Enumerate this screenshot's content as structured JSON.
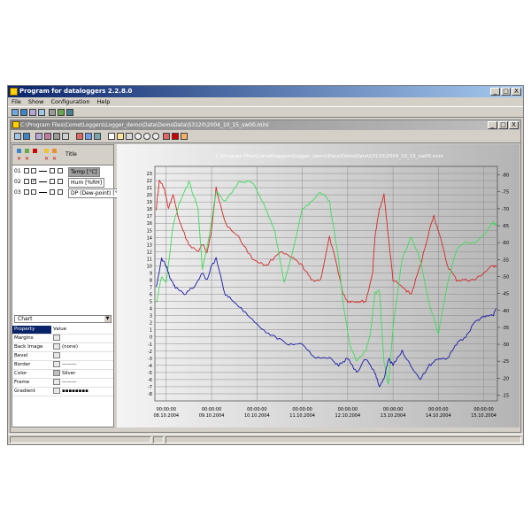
{
  "window": {
    "title": "Program for dataloggers   2.2.8.0",
    "controls": [
      "_",
      "□",
      "X"
    ]
  },
  "menu": [
    "File",
    "Show",
    "Configuration",
    "Help"
  ],
  "document": {
    "path": "C:\\Program Files\\CometLoggers\\Logger_demo\\Data\\DemoData\\S3120\\2004_10_15_sw00.mini",
    "controls": [
      "_",
      "□",
      "X"
    ]
  },
  "series_panel": {
    "headers": {
      "title": "Title"
    },
    "rows": [
      {
        "num": "01",
        "title": "Temp [°C]",
        "selected": true,
        "checked": false
      },
      {
        "num": "02",
        "title": "Hum [%RH]",
        "selected": false,
        "checked": true
      },
      {
        "num": "03",
        "title": "DP (Dew-point) [°C]",
        "selected": false,
        "checked": false
      }
    ]
  },
  "property_panel": {
    "object": "Chart",
    "header": {
      "key": "Property",
      "value": "Value"
    },
    "rows": [
      {
        "key": "Margins",
        "value": ""
      },
      {
        "key": "Back Image",
        "value": "(none)"
      },
      {
        "key": "Bevel",
        "value": ""
      },
      {
        "key": "Border",
        "value": "———"
      },
      {
        "key": "Color",
        "value": "Silver"
      },
      {
        "key": "Frame",
        "value": "———"
      },
      {
        "key": "Gradient",
        "value": "▪▪▪▪▪▪▪▪"
      }
    ]
  },
  "colors": {
    "temp": "#d42a2a",
    "hum": "#3ddc5a",
    "dew": "#1a1aa8",
    "grid": "#8a8a8a"
  },
  "chart_data": {
    "type": "line",
    "title": "C:\\Program Files\\CometLoggers\\Logger_demo\\Data\\DemoData\\S3120\\2004_10_15_sw00.mini",
    "x_ticks": [
      {
        "time": "00:00:00",
        "date": "08.10.2004"
      },
      {
        "time": "00:00:00",
        "date": "09.10.2004"
      },
      {
        "time": "00:00:00",
        "date": "10.10.2004"
      },
      {
        "time": "00:00:00",
        "date": "11.10.2004"
      },
      {
        "time": "00:00:00",
        "date": "12.10.2004"
      },
      {
        "time": "00:00:00",
        "date": "13.10.2004"
      },
      {
        "time": "00:00:00",
        "date": "14.10.2004"
      },
      {
        "time": "00:00:00",
        "date": "15.10.2004"
      }
    ],
    "xlim": [
      7.75,
      15.3
    ],
    "y_left": {
      "ylim": [
        -9,
        24
      ],
      "ticks": [
        -8,
        -7,
        -6,
        -5,
        -4,
        -3,
        -2,
        -1,
        0,
        1,
        2,
        3,
        4,
        5,
        6,
        7,
        8,
        9,
        10,
        11,
        12,
        13,
        14,
        15,
        16,
        17,
        18,
        19,
        20,
        21,
        22,
        23
      ]
    },
    "y_right": {
      "ylim": [
        13.3,
        82.5
      ],
      "ticks": [
        15,
        20,
        25,
        30,
        35,
        40,
        45,
        50,
        55,
        60,
        65,
        70,
        75,
        80
      ]
    },
    "series": [
      {
        "name": "Temp [°C]",
        "axis": "left",
        "x": [
          7.78,
          7.85,
          7.95,
          8.05,
          8.15,
          8.3,
          8.5,
          8.7,
          8.8,
          8.9,
          9.0,
          9.1,
          9.3,
          9.6,
          9.9,
          10.2,
          10.5,
          10.8,
          11.0,
          11.2,
          11.4,
          11.6,
          11.8,
          11.9,
          12.0,
          12.1,
          12.25,
          12.4,
          12.55,
          12.6,
          12.7,
          12.8,
          12.9,
          13.0,
          13.2,
          13.4,
          13.6,
          13.8,
          13.9,
          14.0,
          14.2,
          14.4,
          14.6,
          14.8,
          15.0,
          15.2,
          15.28
        ],
        "y": [
          18,
          22,
          21,
          18,
          20,
          16,
          13,
          12,
          13,
          12,
          15,
          21,
          16,
          14,
          11,
          10,
          12,
          11,
          10,
          8,
          8,
          14,
          9,
          6,
          5,
          5,
          5,
          5,
          9,
          14,
          18,
          20,
          14,
          8,
          7,
          6,
          10,
          15,
          17,
          15,
          10,
          8,
          8,
          8,
          9,
          10,
          10
        ]
      },
      {
        "name": "Hum [%RH]",
        "axis": "right",
        "x": [
          7.78,
          7.9,
          8.0,
          8.15,
          8.3,
          8.5,
          8.7,
          8.8,
          8.95,
          9.1,
          9.3,
          9.6,
          9.9,
          10.2,
          10.4,
          10.6,
          10.8,
          11.0,
          11.2,
          11.4,
          11.6,
          11.8,
          11.9,
          12.05,
          12.2,
          12.4,
          12.5,
          12.6,
          12.7,
          12.8,
          12.9,
          13.0,
          13.2,
          13.4,
          13.6,
          13.8,
          14.0,
          14.2,
          14.4,
          14.6,
          14.8,
          15.0,
          15.2,
          15.28
        ],
        "y": [
          42,
          50,
          48,
          65,
          72,
          78,
          70,
          52,
          62,
          75,
          72,
          78,
          78,
          70,
          63,
          48,
          58,
          70,
          72,
          75,
          72,
          55,
          42,
          30,
          25,
          28,
          33,
          45,
          46,
          25,
          18,
          35,
          55,
          62,
          55,
          42,
          33,
          48,
          58,
          60,
          60,
          62,
          66,
          65
        ]
      },
      {
        "name": "DP (Dew-point) [°C]",
        "axis": "left",
        "x": [
          7.78,
          7.9,
          8.0,
          8.1,
          8.2,
          8.4,
          8.6,
          8.8,
          8.9,
          9.0,
          9.1,
          9.3,
          9.5,
          9.8,
          10.1,
          10.4,
          10.7,
          11.0,
          11.3,
          11.6,
          11.8,
          12.0,
          12.2,
          12.4,
          12.6,
          12.7,
          12.8,
          12.9,
          13.0,
          13.2,
          13.4,
          13.6,
          13.8,
          14.0,
          14.2,
          14.4,
          14.6,
          14.8,
          15.0,
          15.2,
          15.28
        ],
        "y": [
          7,
          11,
          10,
          8,
          7,
          6,
          7,
          9,
          8,
          10,
          11,
          6,
          5,
          3,
          1,
          0,
          -1,
          -1,
          -3,
          -3,
          -4,
          -3,
          -5,
          -3,
          -5,
          -7,
          -6,
          -3,
          -4,
          -2,
          -4,
          -6,
          -4,
          -3,
          -3,
          -1,
          0,
          2,
          3,
          3,
          4
        ]
      }
    ]
  }
}
